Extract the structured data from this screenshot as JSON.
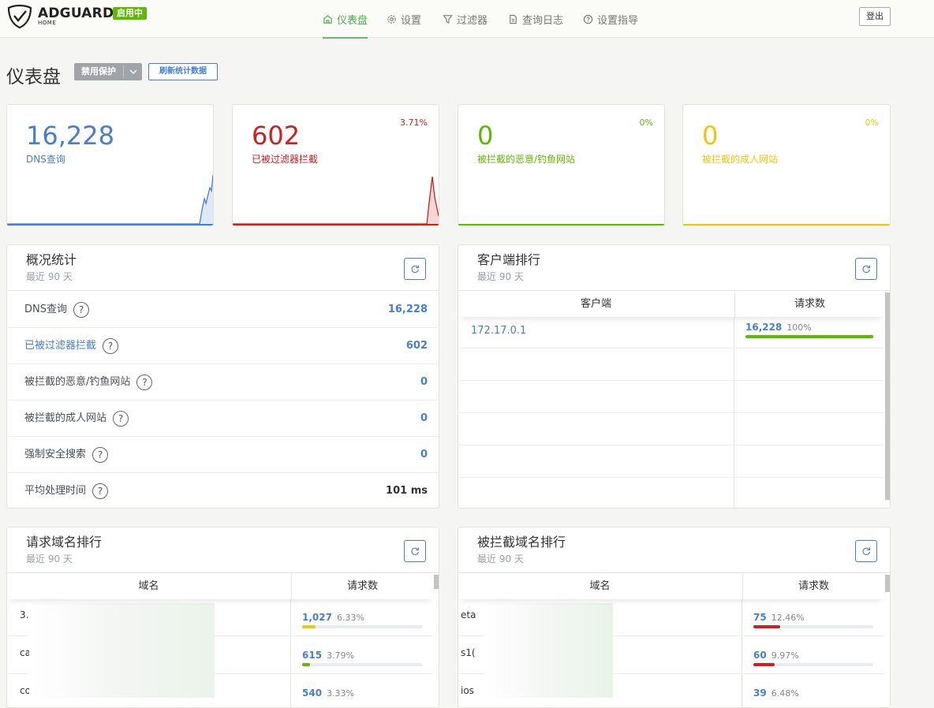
{
  "brand": {
    "name": "ADGUARD",
    "sub": "HOME",
    "status": "启用中"
  },
  "nav": {
    "items": [
      {
        "id": "dashboard",
        "label": "仪表盘",
        "icon": "home-icon",
        "active": true
      },
      {
        "id": "settings",
        "label": "设置",
        "icon": "gear-icon",
        "active": false
      },
      {
        "id": "filters",
        "label": "过滤器",
        "icon": "filter-icon",
        "active": false
      },
      {
        "id": "querylog",
        "label": "查询日志",
        "icon": "document-icon",
        "active": false
      },
      {
        "id": "guide",
        "label": "设置指导",
        "icon": "question-icon",
        "active": false
      }
    ],
    "logout": "登出"
  },
  "page": {
    "title": "仪表盘",
    "disable_btn": "禁用保护",
    "refresh_btn": "刷新统计数据"
  },
  "stats": [
    {
      "value": "16,228",
      "label": "DNS查询",
      "percent": "",
      "color": "#467fcf"
    },
    {
      "value": "602",
      "label": "已被过滤器拦截",
      "percent": "3.71%",
      "color": "#cd201f"
    },
    {
      "value": "0",
      "label": "被拦截的恶意/钓鱼网站",
      "percent": "0%",
      "color": "#5eba00"
    },
    {
      "value": "0",
      "label": "被拦截的成人网站",
      "percent": "0%",
      "color": "#f1c40f"
    }
  ],
  "overview": {
    "title": "概况统计",
    "subtitle": "最近 90 天",
    "rows": [
      {
        "label": "DNS查询",
        "value": "16,228"
      },
      {
        "label": "已被过滤器拦截",
        "value": "602"
      },
      {
        "label": "被拦截的恶意/钓鱼网站",
        "value": "0"
      },
      {
        "label": "被拦截的成人网站",
        "value": "0"
      },
      {
        "label": "强制安全搜索",
        "value": "0"
      },
      {
        "label": "平均处理时间",
        "value": "101 ms"
      }
    ]
  },
  "clients": {
    "title": "客户端排行",
    "subtitle": "最近 90 天",
    "col_client": "客户端",
    "col_requests": "请求数",
    "rows": [
      {
        "client": "172.17.0.1",
        "count": "16,228",
        "percent": "100%",
        "fraction": 1.0,
        "color": "#5eba00"
      }
    ]
  },
  "queried": {
    "title": "请求域名排行",
    "subtitle": "最近 90 天",
    "col_domain": "域名",
    "col_requests": "请求数",
    "rows": [
      {
        "domain": "3.",
        "count": "1,027",
        "percent": "6.33%",
        "fraction": 0.0633,
        "color": "#f1c40f"
      },
      {
        "domain": "ca",
        "count": "615",
        "percent": "3.79%",
        "fraction": 0.0379,
        "color": "#5eba00"
      },
      {
        "domain": "co",
        "count": "540",
        "percent": "3.33%",
        "fraction": 0.0333,
        "color": "#5eba00"
      }
    ]
  },
  "blocked": {
    "title": "被拦截域名排行",
    "subtitle": "最近 90 天",
    "col_domain": "域名",
    "col_requests": "请求数",
    "rows": [
      {
        "domain": "eta",
        "count": "75",
        "percent": "12.46%",
        "fraction": 0.1246,
        "color": "#cd201f"
      },
      {
        "domain": "s1(",
        "count": "60",
        "percent": "9.97%",
        "fraction": 0.0997,
        "color": "#cd201f"
      },
      {
        "domain": "ios",
        "count": "39",
        "percent": "6.48%",
        "fraction": 0.0648,
        "color": "#cd201f"
      }
    ]
  }
}
